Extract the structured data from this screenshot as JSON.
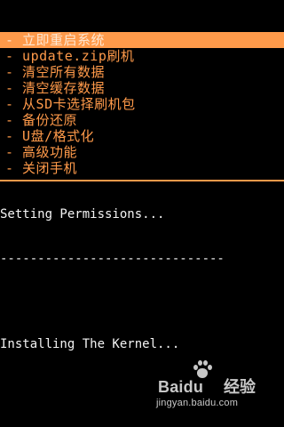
{
  "recovery_menu": {
    "items": [
      {
        "label": "- 立即重启系统",
        "selected": true
      },
      {
        "label": "- update.zip刷机",
        "selected": false
      },
      {
        "label": "- 清空所有数据",
        "selected": false
      },
      {
        "label": "- 清空缓存数据",
        "selected": false
      },
      {
        "label": "- 从SD卡选择刷机包",
        "selected": false
      },
      {
        "label": "- 备份还原",
        "selected": false
      },
      {
        "label": "- U盘/格式化",
        "selected": false
      },
      {
        "label": "- 高级功能",
        "selected": false
      },
      {
        "label": "- 关闭手机",
        "selected": false
      }
    ]
  },
  "log": {
    "line1": "Setting Permissions...",
    "line2": "------------------------------",
    "line3": "",
    "line4": "Installing The Kernel..."
  },
  "watermark": {
    "brand": "Bai",
    "brand_suffix": "du",
    "product": "经验",
    "url": "jingyan.baidu.com"
  },
  "colors": {
    "background": "#000000",
    "menu_text": "#ff9a4a",
    "selected_bg": "#ff9a4a",
    "selected_text": "#ffe7d2",
    "log_text": "#f4f4f4"
  }
}
